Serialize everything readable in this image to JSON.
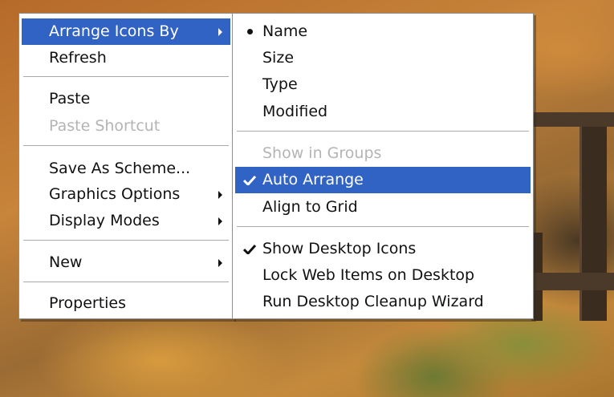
{
  "context_menu": {
    "items": [
      {
        "label": "Arrange Icons By"
      },
      {
        "label": "Refresh"
      },
      {
        "label": "Paste"
      },
      {
        "label": "Paste Shortcut"
      },
      {
        "label": "Save As Scheme..."
      },
      {
        "label": "Graphics Options"
      },
      {
        "label": "Display Modes"
      },
      {
        "label": "New"
      },
      {
        "label": "Properties"
      }
    ]
  },
  "arrange_submenu": {
    "items": [
      {
        "label": "Name"
      },
      {
        "label": "Size"
      },
      {
        "label": "Type"
      },
      {
        "label": "Modified"
      },
      {
        "label": "Show in Groups"
      },
      {
        "label": "Auto Arrange"
      },
      {
        "label": "Align to Grid"
      },
      {
        "label": "Show Desktop Icons"
      },
      {
        "label": "Lock Web Items on Desktop"
      },
      {
        "label": "Run Desktop Cleanup Wizard"
      }
    ]
  },
  "colors": {
    "highlight": "#3163c5",
    "disabled_text": "#b4b4b4",
    "menu_background": "#ffffff"
  },
  "icons": {
    "submenu_arrow": "chevron-right-icon",
    "selected_radio": "bullet-icon",
    "checked": "checkmark-icon"
  }
}
